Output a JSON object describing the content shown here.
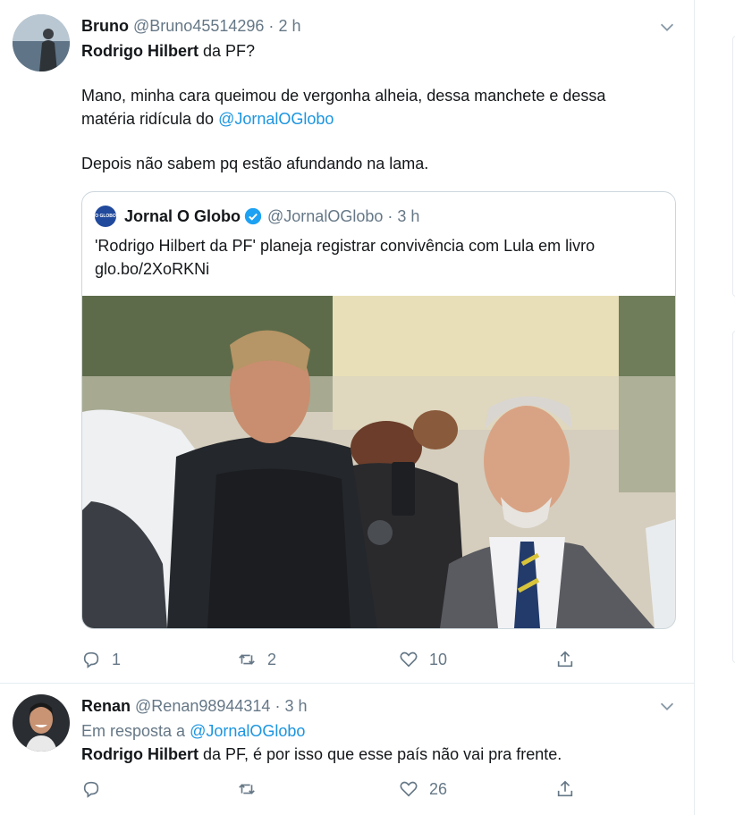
{
  "tweet1": {
    "display_name": "Bruno",
    "handle": "@Bruno45514296",
    "dot": "·",
    "time": "2 h",
    "line1_bold": "Rodrigo Hilbert",
    "line1_rest": " da PF?",
    "line2": "Mano, minha cara queimou de vergonha alheia, dessa manchete e dessa",
    "line3_start": "matéria ridícula do ",
    "line3_mention": "@JornalOGlobo",
    "line4": "Depois não sabem pq estão afundando na lama.",
    "quote": {
      "logo_text": "O GLOBO",
      "display_name": "Jornal O Globo",
      "handle": "@JornalOGlobo",
      "dot": "·",
      "time": "3 h",
      "text_line1": "'Rodrigo Hilbert da PF' planeja registrar convivência com Lula em livro",
      "text_line2": "glo.bo/2XoRKNi"
    },
    "actions": {
      "reply": "1",
      "retweet": "2",
      "like": "10"
    }
  },
  "tweet2": {
    "display_name": "Renan",
    "handle": "@Renan98944314",
    "dot": "·",
    "time": "3 h",
    "reply_prefix": "Em resposta a ",
    "reply_to": "@JornalOGlobo",
    "text_bold": "Rodrigo Hilbert",
    "text_rest": " da PF, é por isso que esse país não vai pra frente.",
    "actions": {
      "reply": "",
      "retweet": "",
      "like": "26"
    }
  },
  "colors": {
    "accent": "#1b95e0",
    "muted": "#657786",
    "border": "#e6ecf0",
    "verified": "#1da1f2"
  }
}
